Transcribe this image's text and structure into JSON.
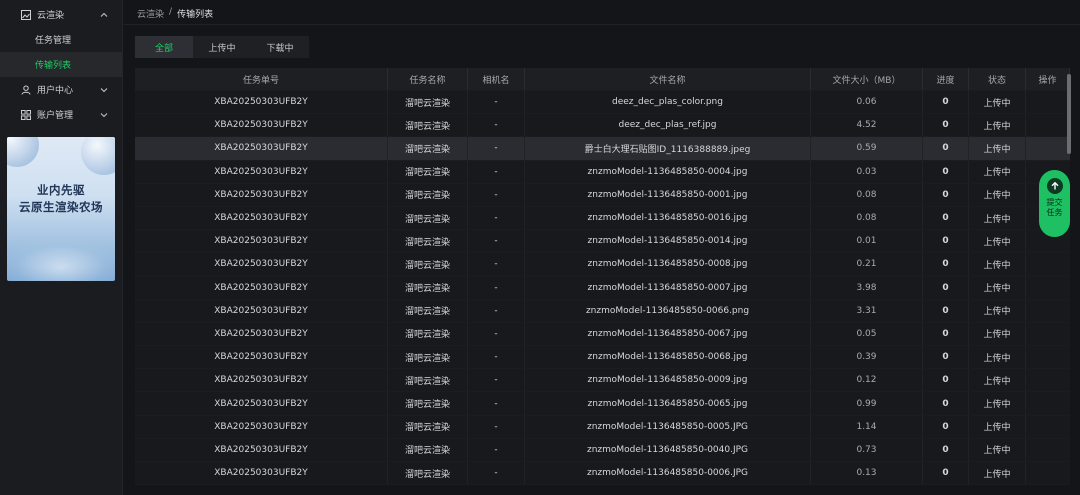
{
  "sidebar": {
    "items": [
      {
        "label": "云渲染",
        "icon": "image-icon",
        "expanded": true
      },
      {
        "label": "任务管理"
      },
      {
        "label": "传输列表",
        "active": true
      },
      {
        "label": "用户中心",
        "icon": "user-icon"
      },
      {
        "label": "账户管理",
        "icon": "grid-icon"
      }
    ],
    "banner": {
      "line1": "业内先驱",
      "line2": "云原生渲染农场"
    }
  },
  "breadcrumb": {
    "parent": "云渲染",
    "separator": "/",
    "current": "传输列表"
  },
  "tabs": [
    {
      "label": "全部",
      "active": true
    },
    {
      "label": "上传中"
    },
    {
      "label": "下载中"
    }
  ],
  "table": {
    "columns": [
      "任务单号",
      "任务名称",
      "相机名",
      "文件名称",
      "文件大小（MB）",
      "进度",
      "状态",
      "操作"
    ],
    "rows": [
      [
        "XBA20250303UFB2Y",
        "溜吧云渲染",
        "-",
        "deez_dec_plas_color.png",
        "0.06",
        "0",
        "上传中",
        ""
      ],
      [
        "XBA20250303UFB2Y",
        "溜吧云渲染",
        "-",
        "deez_dec_plas_ref.jpg",
        "4.52",
        "0",
        "上传中",
        ""
      ],
      [
        "XBA20250303UFB2Y",
        "溜吧云渲染",
        "-",
        "爵士白大理石贴图ID_1116388889.jpeg",
        "0.59",
        "0",
        "上传中",
        ""
      ],
      [
        "XBA20250303UFB2Y",
        "溜吧云渲染",
        "-",
        "znzmoModel-1136485850-0004.jpg",
        "0.03",
        "0",
        "上传中",
        ""
      ],
      [
        "XBA20250303UFB2Y",
        "溜吧云渲染",
        "-",
        "znzmoModel-1136485850-0001.jpg",
        "0.08",
        "0",
        "上传中",
        ""
      ],
      [
        "XBA20250303UFB2Y",
        "溜吧云渲染",
        "-",
        "znzmoModel-1136485850-0016.jpg",
        "0.08",
        "0",
        "上传中",
        ""
      ],
      [
        "XBA20250303UFB2Y",
        "溜吧云渲染",
        "-",
        "znzmoModel-1136485850-0014.jpg",
        "0.01",
        "0",
        "上传中",
        ""
      ],
      [
        "XBA20250303UFB2Y",
        "溜吧云渲染",
        "-",
        "znzmoModel-1136485850-0008.jpg",
        "0.21",
        "0",
        "上传中",
        ""
      ],
      [
        "XBA20250303UFB2Y",
        "溜吧云渲染",
        "-",
        "znzmoModel-1136485850-0007.jpg",
        "3.98",
        "0",
        "上传中",
        ""
      ],
      [
        "XBA20250303UFB2Y",
        "溜吧云渲染",
        "-",
        "znzmoModel-1136485850-0066.png",
        "3.31",
        "0",
        "上传中",
        ""
      ],
      [
        "XBA20250303UFB2Y",
        "溜吧云渲染",
        "-",
        "znzmoModel-1136485850-0067.jpg",
        "0.05",
        "0",
        "上传中",
        ""
      ],
      [
        "XBA20250303UFB2Y",
        "溜吧云渲染",
        "-",
        "znzmoModel-1136485850-0068.jpg",
        "0.39",
        "0",
        "上传中",
        ""
      ],
      [
        "XBA20250303UFB2Y",
        "溜吧云渲染",
        "-",
        "znzmoModel-1136485850-0009.jpg",
        "0.12",
        "0",
        "上传中",
        ""
      ],
      [
        "XBA20250303UFB2Y",
        "溜吧云渲染",
        "-",
        "znzmoModel-1136485850-0065.jpg",
        "0.99",
        "0",
        "上传中",
        ""
      ],
      [
        "XBA20250303UFB2Y",
        "溜吧云渲染",
        "-",
        "znzmoModel-1136485850-0005.JPG",
        "1.14",
        "0",
        "上传中",
        ""
      ],
      [
        "XBA20250303UFB2Y",
        "溜吧云渲染",
        "-",
        "znzmoModel-1136485850-0040.JPG",
        "0.73",
        "0",
        "上传中",
        ""
      ],
      [
        "XBA20250303UFB2Y",
        "溜吧云渲染",
        "-",
        "znzmoModel-1136485850-0006.JPG",
        "0.13",
        "0",
        "上传中",
        ""
      ]
    ],
    "highlighted_row": 2
  },
  "fab": {
    "label": "提交任务",
    "icon": "arrow-up-icon"
  },
  "colors": {
    "accent": "#1fcf66",
    "background": "#141518",
    "sidebar": "#1b1c20"
  }
}
